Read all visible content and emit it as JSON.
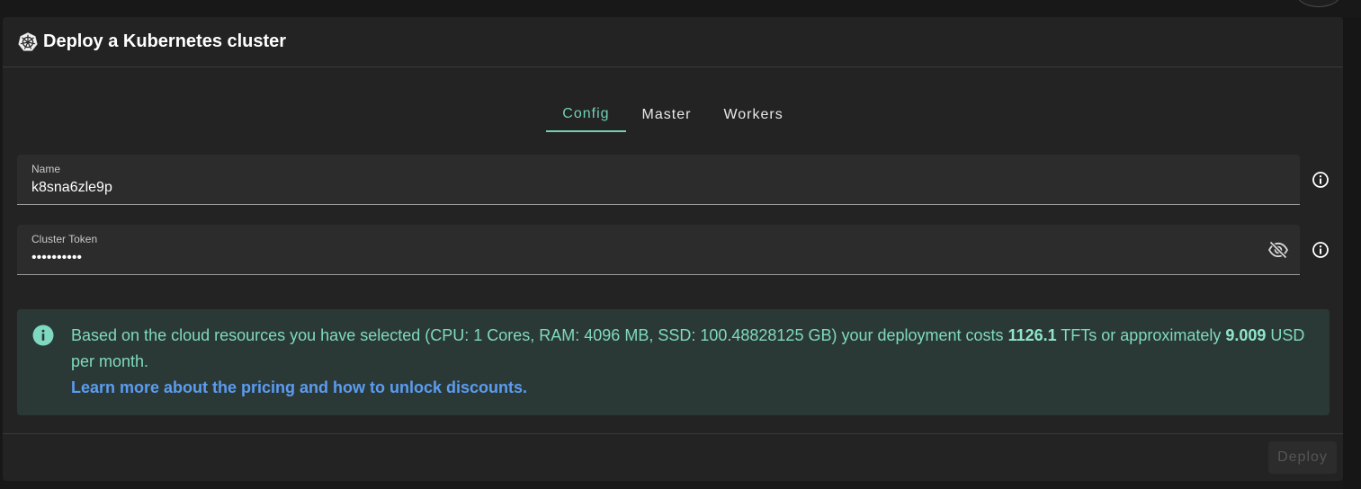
{
  "header": {
    "title": "Deploy a Kubernetes cluster",
    "icon": "kubernetes-icon"
  },
  "tabs": [
    {
      "label": "Config",
      "active": true
    },
    {
      "label": "Master",
      "active": false
    },
    {
      "label": "Workers",
      "active": false
    }
  ],
  "form": {
    "name": {
      "label": "Name",
      "value": "k8sna6zle9p"
    },
    "cluster_token": {
      "label": "Cluster Token",
      "value": "••••••••••",
      "visibility_icon": "eye-off-icon"
    }
  },
  "alert": {
    "icon": "info-icon",
    "text_prefix": "Based on the cloud resources you have selected (CPU: 1 Cores, RAM: 4096 MB, SSD: 100.48828125 GB) your deployment costs ",
    "tft_cost": "1126.1",
    "text_middle": " TFTs or approximately ",
    "usd_cost": "9.009",
    "text_suffix": " USD per month.",
    "link_text": "Learn more about the pricing and how to unlock discounts."
  },
  "footer": {
    "deploy_label": "Deploy"
  },
  "colors": {
    "accent": "#6fd1b5",
    "link": "#5b9cf2",
    "alert_bg": "#2b3936",
    "card_bg": "#232323"
  }
}
